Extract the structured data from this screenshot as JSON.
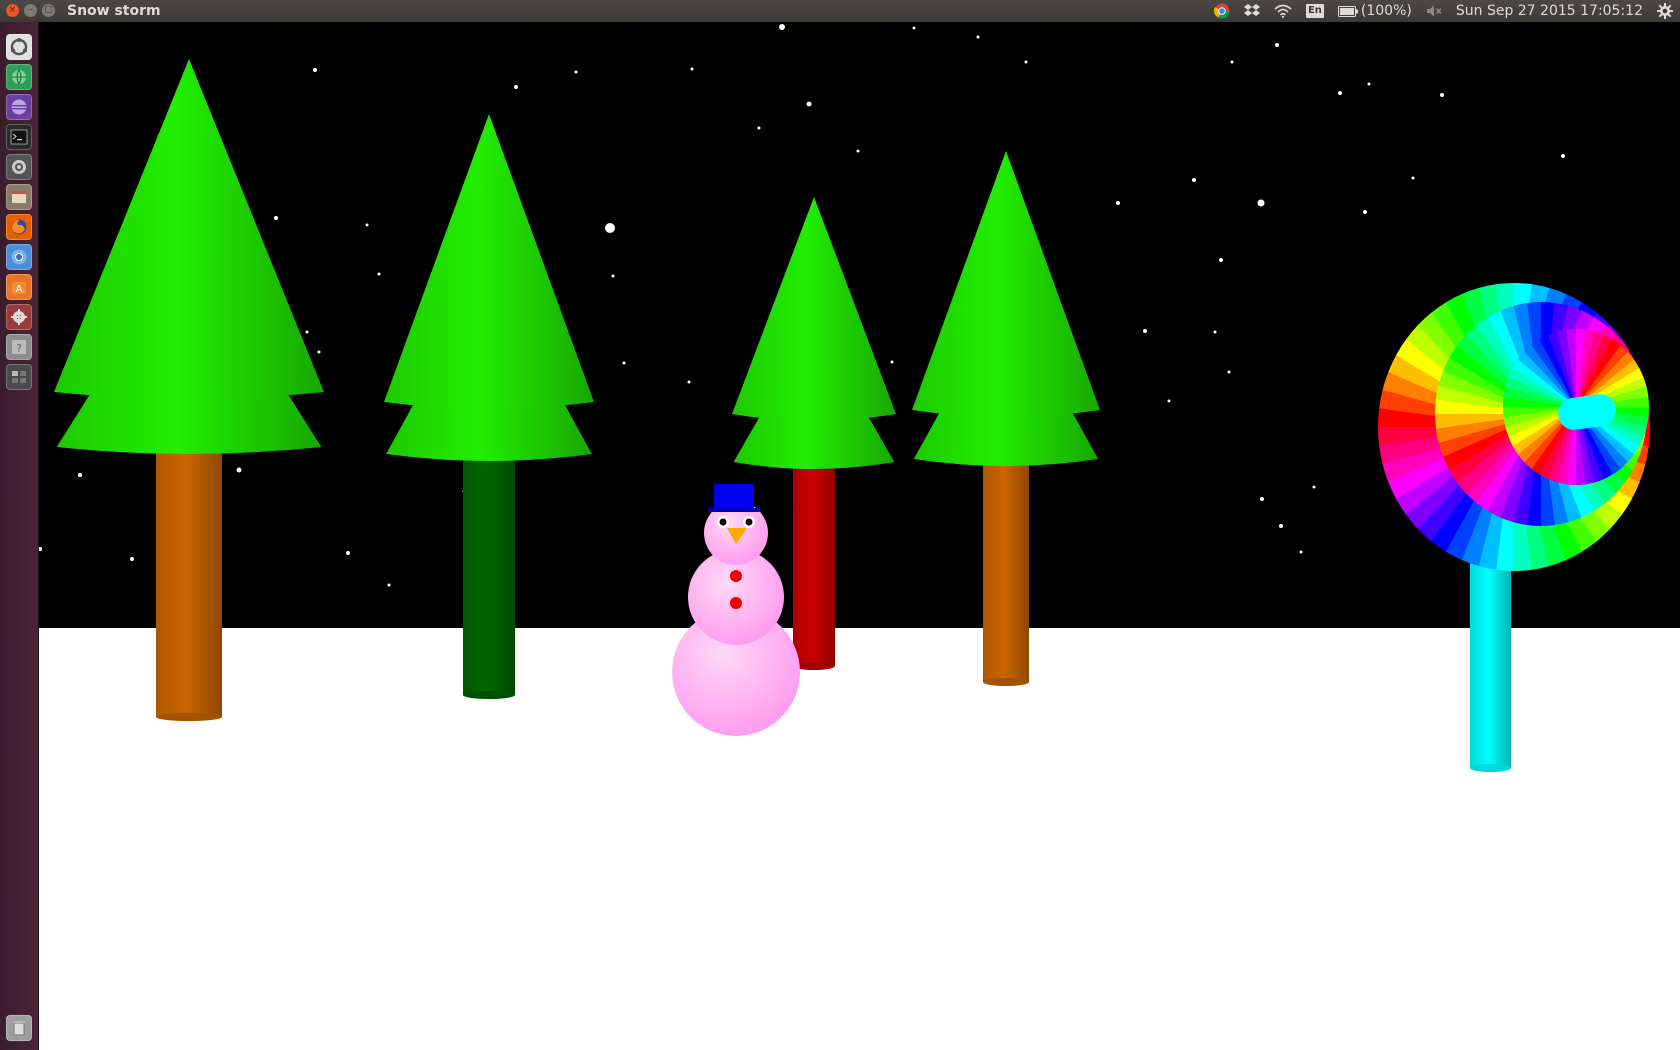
{
  "window": {
    "title": "Snow storm",
    "close_glyph": "×",
    "minimize_glyph": "–",
    "maximize_glyph": "▢"
  },
  "panel": {
    "language": "En",
    "battery_text": "(100%)",
    "clock": "Sun Sep 27 2015 17:05:12",
    "indicator_icons": [
      "chrome-status-icon",
      "dropbox-icon",
      "wifi-icon",
      "keyboard-layout-icon",
      "battery-icon",
      "volume-muted-icon",
      "system-gear-icon"
    ]
  },
  "launcher": {
    "items": [
      {
        "name": "dash-home",
        "icon": "ubuntu-logo-icon",
        "color": "#e0e0e0"
      },
      {
        "name": "app-green",
        "icon": "globe-icon",
        "color": "#2e9e5b"
      },
      {
        "name": "app-purple",
        "icon": "eclipse-icon",
        "color": "#6b3fa0"
      },
      {
        "name": "terminal",
        "icon": "terminal-icon",
        "color": "#2b2b2b"
      },
      {
        "name": "app-settings",
        "icon": "circle-app-icon",
        "color": "#555555"
      },
      {
        "name": "files",
        "icon": "files-icon",
        "color": "#8a7a66"
      },
      {
        "name": "firefox",
        "icon": "firefox-icon",
        "color": "#e66000"
      },
      {
        "name": "chromium",
        "icon": "chromium-icon",
        "color": "#4a8fd8"
      },
      {
        "name": "software-center",
        "icon": "software-center-icon",
        "color": "#e8752a"
      },
      {
        "name": "system-settings",
        "icon": "settings-gear-icon",
        "color": "#9a3b3b"
      },
      {
        "name": "help",
        "icon": "help-icon",
        "color": "#8d8d8d"
      },
      {
        "name": "workspace-switcher",
        "icon": "workspace-icon",
        "color": "#4a4a4a"
      }
    ],
    "trash": {
      "name": "trash",
      "icon": "trash-icon",
      "color": "#9e9e9e"
    }
  },
  "scene": {
    "sky_color": "#000000",
    "ground_color": "#ffffff",
    "foliage_color": "#22ee00",
    "trees": [
      {
        "name": "tree-1",
        "trunk_color": "#cc6600"
      },
      {
        "name": "tree-2",
        "trunk_color": "#006600"
      },
      {
        "name": "tree-3",
        "trunk_color": "#cc0000"
      },
      {
        "name": "tree-4",
        "trunk_color": "#cc6600"
      }
    ],
    "snowman": {
      "body_color": "#ff99ee",
      "hat_color": "#0000ee",
      "nose_color": "#ffaa00",
      "button_color": "#ee0000"
    },
    "lollipop": {
      "stick_color": "#00ffff",
      "candy": "rainbow"
    }
  }
}
